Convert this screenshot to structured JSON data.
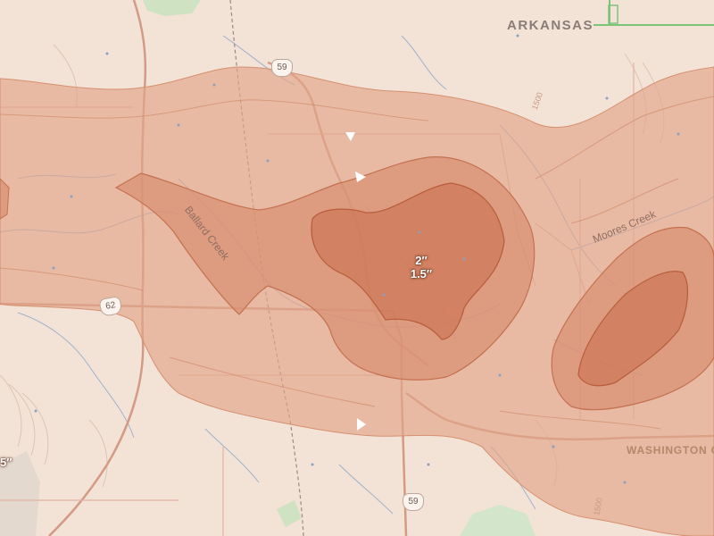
{
  "map": {
    "state_label": "ARKANSAS",
    "county_label": "WASHINGTON C",
    "creek_labels": [
      "Ballard Creek",
      "Moores Creek"
    ],
    "route_shields": [
      "59",
      "59",
      "62"
    ],
    "contour_labels": [
      "1500",
      "1500"
    ],
    "snowfall_labels": {
      "center_upper": "2″",
      "center_lower": "1.5″",
      "edge_partial": "5″"
    },
    "colors": {
      "base_terrain": "#f3e2d6",
      "band_outer": "#e2a488",
      "band_mid": "#d98e70",
      "band_core": "#c86e4a",
      "band_border": "#c4714f",
      "stream": "#8aa8c8",
      "road": "#d49a86",
      "state_line": "#7cc47a"
    }
  }
}
